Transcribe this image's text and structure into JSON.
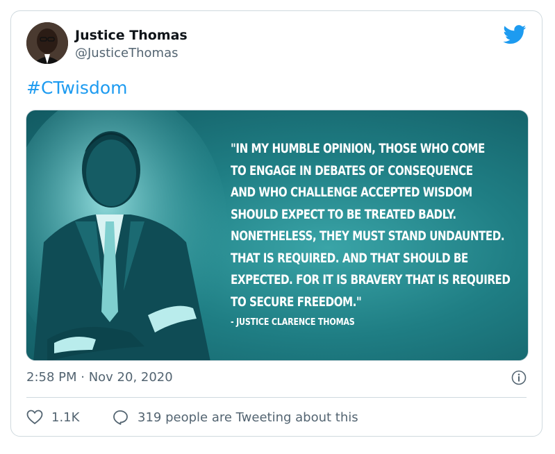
{
  "tweet": {
    "author_name": "Justice Thomas",
    "author_handle": "@JusticeThomas",
    "text": "#CTwisdom",
    "brand_color": "#1d9bf0",
    "image": {
      "quote_lines": [
        "\"IN MY HUMBLE OPINION, THOSE WHO COME",
        "TO ENGAGE IN DEBATES OF CONSEQUENCE",
        "AND WHO CHALLENGE ACCEPTED WISDOM",
        "SHOULD EXPECT TO BE TREATED BADLY.",
        "NONETHELESS, THEY MUST STAND UNDAUNTED.",
        "THAT IS REQUIRED. AND THAT SHOULD BE",
        "EXPECTED. FOR IT IS BRAVERY THAT IS REQUIRED",
        "TO SECURE FREEDOM.\""
      ],
      "attribution": "- JUSTICE CLARENCE THOMAS",
      "background_color": "#1f7e84"
    },
    "timestamp": "2:58 PM · Nov 20, 2020",
    "likes_count": "1.1K",
    "conversation_text": "319 people are Tweeting about this",
    "icons": {
      "platform": "twitter-bird-icon",
      "info": "info-icon",
      "like": "heart-icon",
      "reply": "speech-bubble-icon"
    }
  }
}
